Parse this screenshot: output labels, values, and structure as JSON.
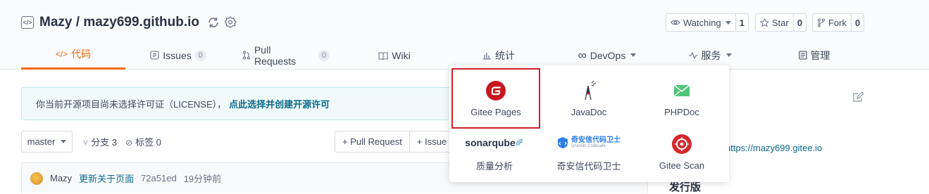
{
  "repo": {
    "owner": "Mazy",
    "separator": " / ",
    "name": "mazy699.github.io"
  },
  "social": {
    "watch_label": "Watching",
    "watch_count": "1",
    "star_label": "Star",
    "star_count": "0",
    "fork_label": "Fork",
    "fork_count": "0"
  },
  "tabs": [
    {
      "label": "代码",
      "active": true
    },
    {
      "label": "Issues",
      "badge": "0"
    },
    {
      "label": "Pull Requests",
      "badge": "0"
    },
    {
      "label": "Wiki"
    },
    {
      "label": "统计"
    },
    {
      "label": "DevOps"
    },
    {
      "label": "服务"
    },
    {
      "label": "管理"
    }
  ],
  "notice": {
    "text": "你当前开源项目尚未选择许可证（LICENSE），",
    "link": "点此选择并创建开源许可"
  },
  "branch": {
    "current": "master",
    "branches_label": "分支 3",
    "tags_label": "标签 0",
    "pull_request_label": "+ Pull Request",
    "issue_label": "+ Issue"
  },
  "commit": {
    "author": "Mazy",
    "message": "更新关于页面",
    "hash": "72a51ed",
    "time": "19分钟前"
  },
  "sidebar": {
    "link": "https://mazy699.gitee.io",
    "heading": "发行版"
  },
  "services_menu": [
    {
      "label": "Gitee Pages",
      "highlighted": true
    },
    {
      "label": "JavaDoc"
    },
    {
      "label": "PHPDoc"
    },
    {
      "label": "质量分析",
      "logo_text": "sonarqube"
    },
    {
      "label": "奇安信代码卫士",
      "logo_text": "奇安信代码卫士",
      "logo_sub": "Qi'anxin Codesafe"
    },
    {
      "label": "Gitee Scan"
    }
  ],
  "colors": {
    "accent": "#f46a12",
    "link": "#0c6a8a",
    "highlight_border": "#d0202a",
    "gitee_red": "#c7161e"
  }
}
